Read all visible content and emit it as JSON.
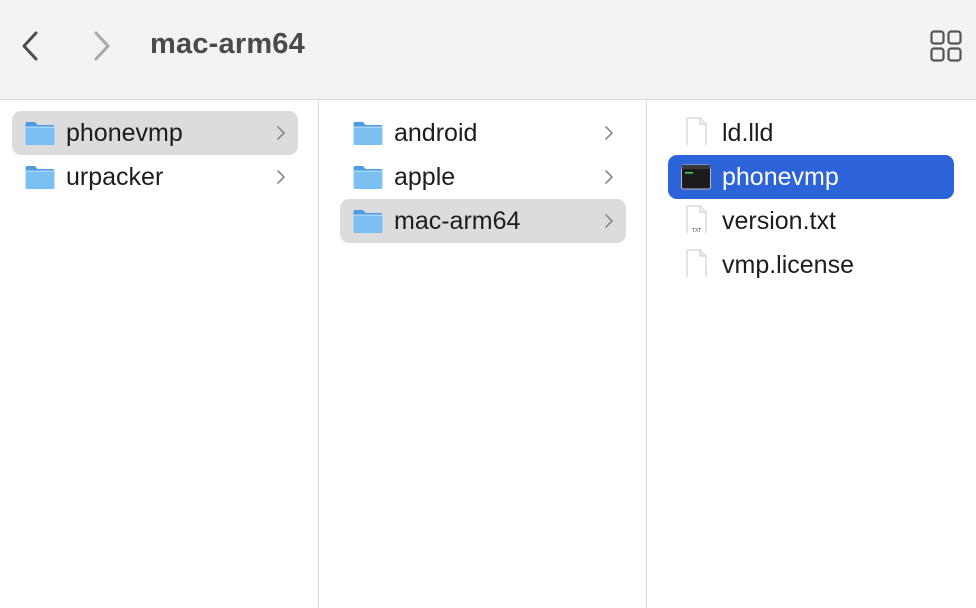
{
  "window": {
    "title": "mac-arm64"
  },
  "toolbar": {
    "back_icon": "chevron-left-icon",
    "forward_icon": "chevron-right-icon",
    "view_icon": "grid-view-icon"
  },
  "columns": [
    {
      "items": [
        {
          "label": "phonevmp",
          "kind": "folder",
          "has_children": true,
          "state": "selected-inactive"
        },
        {
          "label": "urpacker",
          "kind": "folder",
          "has_children": true,
          "state": "normal"
        }
      ]
    },
    {
      "items": [
        {
          "label": "android",
          "kind": "folder",
          "has_children": true,
          "state": "normal"
        },
        {
          "label": "apple",
          "kind": "folder",
          "has_children": true,
          "state": "normal"
        },
        {
          "label": "mac-arm64",
          "kind": "folder",
          "has_children": true,
          "state": "selected-inactive"
        }
      ]
    },
    {
      "items": [
        {
          "label": "ld.lld",
          "kind": "document",
          "has_children": false,
          "state": "normal"
        },
        {
          "label": "phonevmp",
          "kind": "executable",
          "has_children": false,
          "state": "selected-active"
        },
        {
          "label": "version.txt",
          "kind": "text",
          "has_children": false,
          "state": "normal"
        },
        {
          "label": "vmp.license",
          "kind": "document",
          "has_children": false,
          "state": "normal"
        }
      ]
    }
  ],
  "colors": {
    "accent": "#2c63d8",
    "inactive_selection": "#dcdcdc",
    "folder": "#6fb6ee"
  }
}
